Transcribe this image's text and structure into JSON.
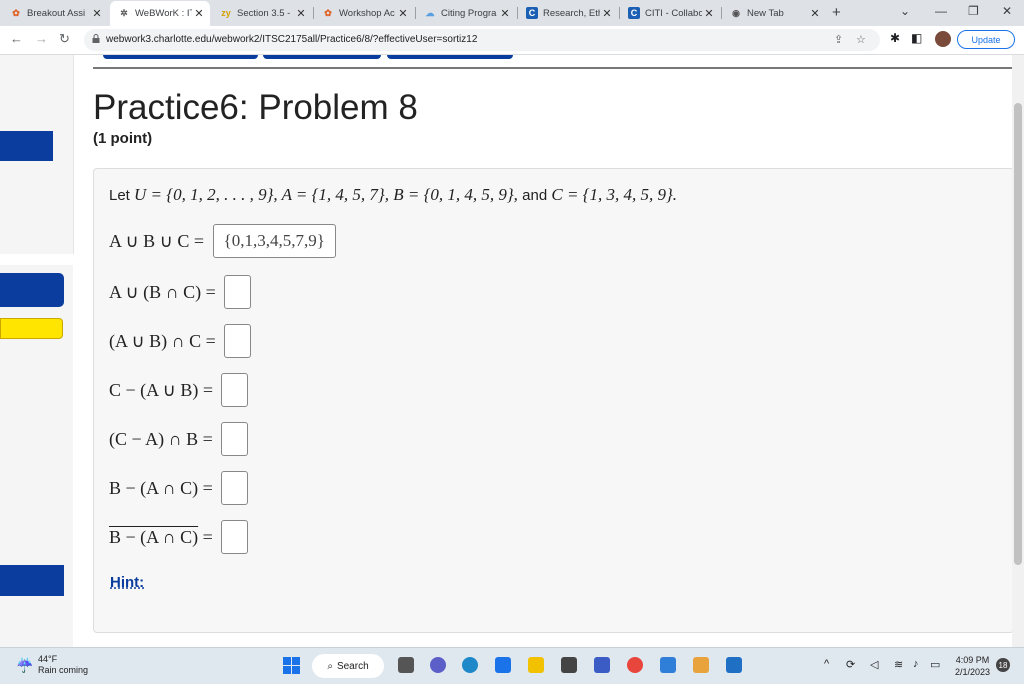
{
  "browser": {
    "tabs": [
      {
        "label": "Breakout Assi",
        "icon": "breakout-icon"
      },
      {
        "label": "WeBWorK : IT",
        "icon": "webwork-icon"
      },
      {
        "label": "Section 3.5 -",
        "icon": "section-icon"
      },
      {
        "label": "Workshop Ac",
        "icon": "workshop-icon"
      },
      {
        "label": "Citing Progra",
        "icon": "cloud-icon"
      },
      {
        "label": "Research, Eth",
        "icon": "citi-icon"
      },
      {
        "label": "CITI - Collabo",
        "icon": "citi-icon"
      },
      {
        "label": "New Tab",
        "icon": "chrome-icon"
      }
    ],
    "url": "webwork3.charlotte.edu/webwork2/ITSC2175all/Practice6/8/?effectiveUser=sortiz12",
    "update_label": "Update"
  },
  "page": {
    "title": "Practice6: Problem 8",
    "points": "(1 point)",
    "prompt_lead": "Let ",
    "prompt_math": "U = {0, 1, 2, . . . , 9}, A = {1, 4, 5, 7}, B = {0, 1, 4, 5, 9}, ",
    "prompt_and": "and ",
    "prompt_math2": "C = {1, 3, 4, 5, 9}.",
    "questions": [
      {
        "expr": "A ∪ B ∪ C = ",
        "answer": "{0,1,3,4,5,7,9}"
      },
      {
        "expr": "A ∪ (B ∩ C) = ",
        "answer": ""
      },
      {
        "expr": "(A ∪ B) ∩ C = ",
        "answer": ""
      },
      {
        "expr": "C − (A ∪ B) = ",
        "answer": ""
      },
      {
        "expr": "(C − A) ∩ B = ",
        "answer": ""
      },
      {
        "expr": "B − (A ∩ C) = ",
        "answer": ""
      },
      {
        "expr": "B − (A ∩ C)",
        "tail": " = ",
        "answer": ""
      }
    ],
    "hint_label": "Hint:"
  },
  "taskbar": {
    "temperature": "44°F",
    "weather": "Rain coming",
    "search_label": "Search",
    "time": "4:09 PM",
    "date": "2/1/2023",
    "notifications": "18"
  },
  "colors": {
    "accent": "#0a3d9e",
    "highlight": "#ffe500"
  }
}
